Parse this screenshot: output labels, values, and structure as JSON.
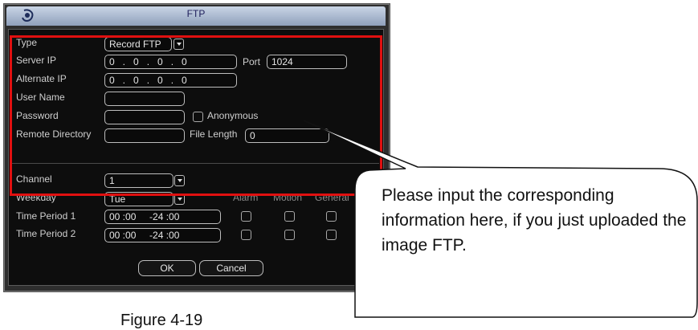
{
  "dialog": {
    "title": "FTP",
    "labels": {
      "type": "Type",
      "server_ip": "Server IP",
      "alternate_ip": "Alternate IP",
      "user_name": "User Name",
      "password": "Password",
      "remote_directory": "Remote Directory",
      "channel": "Channel",
      "weekday": "Weekday",
      "time_period_1": "Time Period 1",
      "time_period_2": "Time Period 2",
      "port": "Port",
      "anonymous": "Anonymous",
      "file_length": "File Length"
    },
    "values": {
      "type": "Record FTP",
      "server_ip": "0   .   0   .   0   .   0",
      "alternate_ip": "0   .   0   .   0   .   0",
      "port": "1024",
      "user_name": "",
      "password": "",
      "remote_directory": "",
      "file_length": "0",
      "channel": "1",
      "weekday": "Tue",
      "time_period_1": "00 :00     -24 :00",
      "time_period_2": "00 :00     -24 :00"
    },
    "columns": {
      "alarm": "Alarm",
      "motion": "Motion",
      "general": "General"
    },
    "buttons": {
      "ok": "OK",
      "cancel": "Cancel"
    },
    "highlight_color": "#e01010"
  },
  "callout": {
    "text": "Please input the corresponding information here, if you just uploaded the image FTP."
  },
  "caption": "Figure 4-19"
}
